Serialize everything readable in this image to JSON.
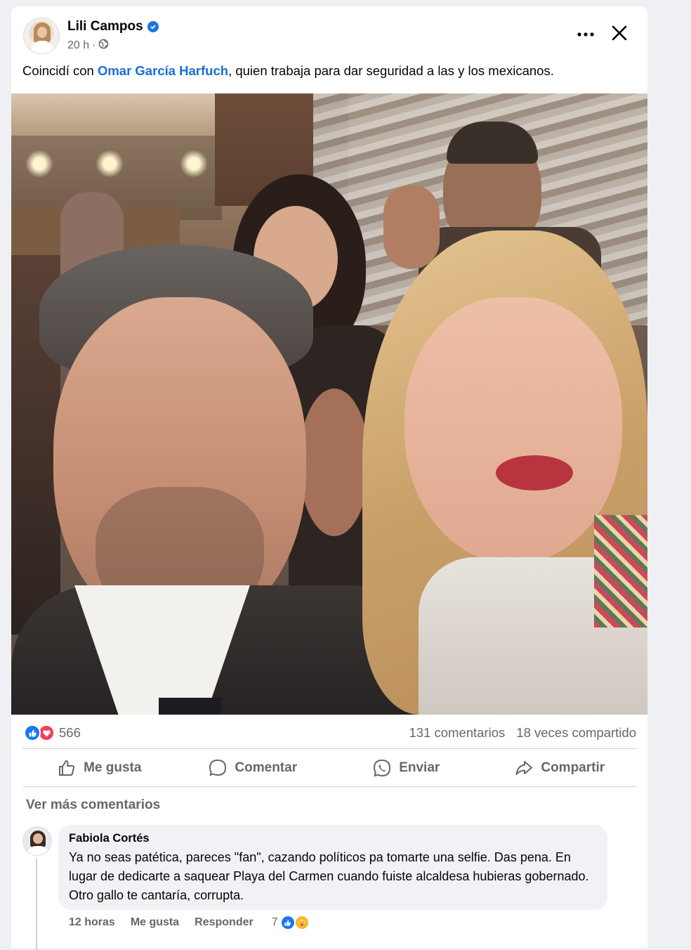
{
  "post": {
    "author": "Lili Campos",
    "time": "20 h",
    "dot": "·",
    "text_before": "Coincidí con ",
    "mention": "Omar García Harfuch",
    "text_after": ", quien trabaja para dar seguridad a las y los mexicanos."
  },
  "icons": {
    "verified": "verified-badge-icon",
    "privacy": "globe-icon",
    "more": "more-options-icon",
    "close": "close-icon"
  },
  "stats": {
    "reaction_count": "566",
    "comments": "131 comentarios",
    "shares": "18 veces compartido"
  },
  "actions": {
    "like": "Me gusta",
    "comment": "Comentar",
    "send": "Enviar",
    "share": "Compartir"
  },
  "comments_section": {
    "more_comments": "Ver más comentarios",
    "comment": {
      "author": "Fabiola Cortés",
      "text": "Ya no seas patética, pareces \"fan\", cazando políticos pa tomarte una selfie. Das pena. En lugar de dedicarte a saquear Playa del Carmen cuando fuiste alcaldesa hubieras gobernado. Otro gallo te cantaría, corrupta.",
      "time": "12 horas",
      "like": "Me gusta",
      "reply": "Responder",
      "reaction_count": "7"
    }
  },
  "colors": {
    "accent": "#1877f2",
    "mention": "#1a6ed8",
    "secondary_text": "#65676b",
    "love": "#f33e58"
  }
}
